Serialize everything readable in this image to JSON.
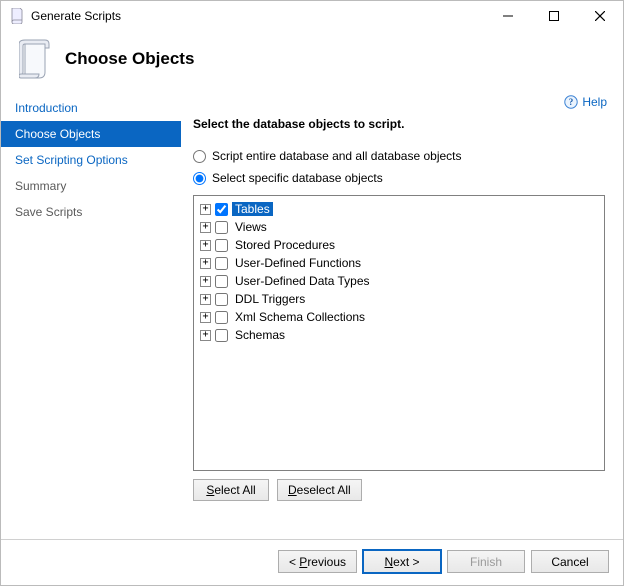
{
  "window": {
    "title": "Generate Scripts"
  },
  "header": {
    "title": "Choose Objects"
  },
  "help": {
    "label": "Help"
  },
  "sidebar": {
    "items": [
      {
        "label": "Introduction",
        "state": "link"
      },
      {
        "label": "Choose Objects",
        "state": "active"
      },
      {
        "label": "Set Scripting Options",
        "state": "link"
      },
      {
        "label": "Summary",
        "state": "muted"
      },
      {
        "label": "Save Scripts",
        "state": "muted"
      }
    ]
  },
  "content": {
    "instruction": "Select the database objects to script.",
    "radio_all": "Script entire database and all database objects",
    "radio_specific": "Select specific database objects",
    "radio_selected": "specific",
    "tree": [
      {
        "label": "Tables",
        "checked": true,
        "selected": true
      },
      {
        "label": "Views",
        "checked": false,
        "selected": false
      },
      {
        "label": "Stored Procedures",
        "checked": false,
        "selected": false
      },
      {
        "label": "User-Defined Functions",
        "checked": false,
        "selected": false
      },
      {
        "label": "User-Defined Data Types",
        "checked": false,
        "selected": false
      },
      {
        "label": "DDL Triggers",
        "checked": false,
        "selected": false
      },
      {
        "label": "Xml Schema Collections",
        "checked": false,
        "selected": false
      },
      {
        "label": "Schemas",
        "checked": false,
        "selected": false
      }
    ],
    "select_all": "Select All",
    "deselect_all": "Deselect All"
  },
  "footer": {
    "previous": "< Previous",
    "next": "Next >",
    "finish": "Finish",
    "cancel": "Cancel"
  }
}
